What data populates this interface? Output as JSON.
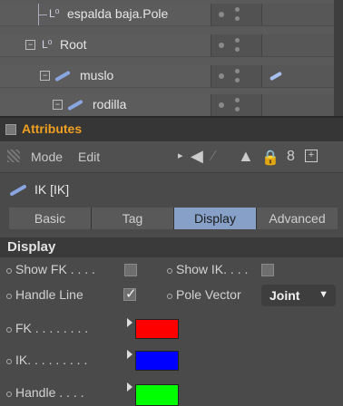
{
  "tree": {
    "items": [
      {
        "label": "espalda baja.Pole",
        "icon": "null-object-icon"
      },
      {
        "label": "Root",
        "icon": "null-object-icon"
      },
      {
        "label": "muslo",
        "icon": "bone-icon"
      },
      {
        "label": "rodilla",
        "icon": "bone-icon"
      }
    ]
  },
  "attributes": {
    "title": "Attributes",
    "menu": {
      "mode": "Mode",
      "edit": "Edit"
    },
    "object_name": "IK [IK]",
    "tabs": [
      {
        "label": "Basic",
        "active": false
      },
      {
        "label": "Tag",
        "active": false
      },
      {
        "label": "Display",
        "active": true
      },
      {
        "label": "Advanced",
        "active": false
      }
    ],
    "section_title": "Display",
    "fields": {
      "show_fk": {
        "label": "Show FK . . . .",
        "checked": false
      },
      "show_ik": {
        "label": "Show IK. . . .",
        "checked": false
      },
      "handle_line": {
        "label": "Handle Line",
        "checked": true
      },
      "pole_vector": {
        "label": "Pole Vector",
        "value": "Joint"
      },
      "fk": {
        "label": "FK . . . . . . . .",
        "color": "#ff0000"
      },
      "ik": {
        "label": "IK. . . . . . . . .",
        "color": "#0000ff"
      },
      "handle": {
        "label": "Handle . . . .",
        "color": "#00ff00"
      }
    }
  },
  "colors": {
    "accent": "#f0a020",
    "active_tab": "#86a0c8"
  }
}
